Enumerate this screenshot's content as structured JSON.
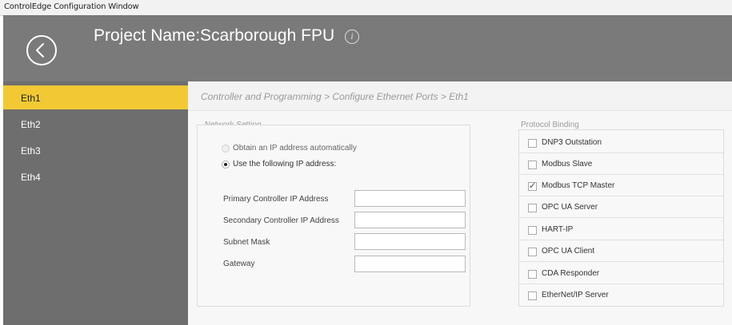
{
  "window": {
    "title": "ControlEdge Configuration Window"
  },
  "header": {
    "project_title": "Project Name:Scarborough FPU"
  },
  "sidebar": {
    "items": [
      {
        "label": "Eth1",
        "active": true
      },
      {
        "label": "Eth2",
        "active": false
      },
      {
        "label": "Eth3",
        "active": false
      },
      {
        "label": "Eth4",
        "active": false
      }
    ]
  },
  "breadcrumb": {
    "text": "Controller and Programming > Configure Ethernet Ports > Eth1"
  },
  "network": {
    "group_label": "Network Setting",
    "option_auto": "Obtain an IP address automatically",
    "option_manual": "Use the following IP address:",
    "selected": "manual",
    "fields": [
      {
        "label": "Primary Controller IP Address",
        "value": ""
      },
      {
        "label": "Secondary Controller IP Address",
        "value": ""
      },
      {
        "label": "Subnet Mask",
        "value": ""
      },
      {
        "label": "Gateway",
        "value": ""
      }
    ]
  },
  "protocol": {
    "group_label": "Protocol Binding",
    "items": [
      {
        "label": "DNP3 Outstation",
        "checked": false
      },
      {
        "label": "Modbus Slave",
        "checked": false
      },
      {
        "label": "Modbus TCP Master",
        "checked": true
      },
      {
        "label": "OPC UA Server",
        "checked": false
      },
      {
        "label": "HART-IP",
        "checked": false
      },
      {
        "label": "OPC UA Client",
        "checked": false
      },
      {
        "label": "CDA Responder",
        "checked": false
      },
      {
        "label": "EtherNet/IP Server",
        "checked": false
      }
    ]
  },
  "colors": {
    "accent": "#f2c935",
    "header": "#7a7a7a",
    "sidebar": "#6e6e6e"
  }
}
